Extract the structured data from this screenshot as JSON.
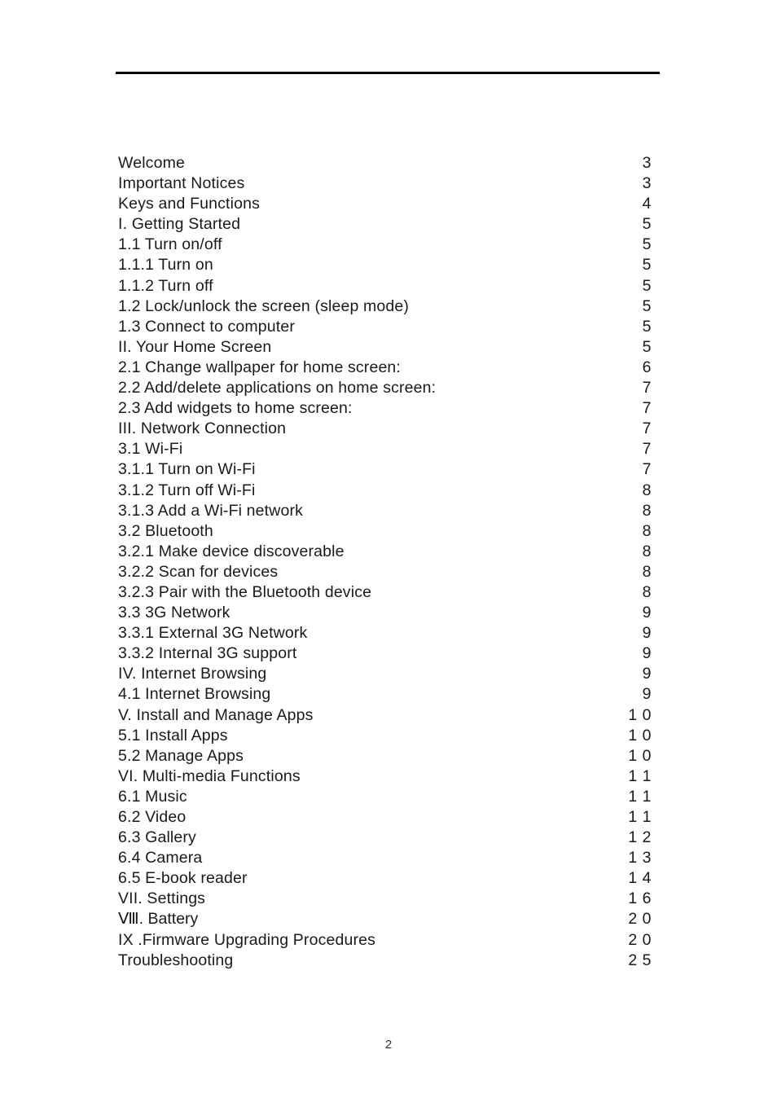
{
  "document": {
    "footer_page_number": "2",
    "header_rule_color": "#000000",
    "text_color": "#1a1a1a"
  },
  "toc": {
    "entries": [
      {
        "title": "Welcome",
        "page": "3"
      },
      {
        "title": "Important Notices",
        "page": "3"
      },
      {
        "title": "Keys and Functions",
        "page": "4"
      },
      {
        "title": "I. Getting Started",
        "page": "5"
      },
      {
        "title": "1.1 Turn on/off",
        "page": "5"
      },
      {
        "title": "1.1.1 Turn on",
        "page": "5"
      },
      {
        "title": "1.1.2 Turn off",
        "page": "5"
      },
      {
        "title": "1.2 Lock/unlock the screen (sleep mode)",
        "page": "5"
      },
      {
        "title": "1.3 Connect to computer",
        "page": "5"
      },
      {
        "title": "II. Your Home Screen",
        "page": "5"
      },
      {
        "title": "2.1 Change wallpaper for home screen:",
        "page": "6"
      },
      {
        "title": "2.2 Add/delete applications on home screen:",
        "page": "7"
      },
      {
        "title": "2.3 Add widgets to home screen:",
        "page": "7"
      },
      {
        "title": "III. Network Connection",
        "page": "7"
      },
      {
        "title": "3.1 Wi-Fi",
        "page": "7"
      },
      {
        "title": "3.1.1 Turn on Wi-Fi",
        "page": "7"
      },
      {
        "title": "3.1.2 Turn off Wi-Fi",
        "page": "8"
      },
      {
        "title": "3.1.3 Add a Wi-Fi network",
        "page": "8"
      },
      {
        "title": "3.2 Bluetooth",
        "page": "8"
      },
      {
        "title": "3.2.1 Make device discoverable",
        "page": "8"
      },
      {
        "title": "3.2.2 Scan for devices",
        "page": "8"
      },
      {
        "title": "3.2.3 Pair with the Bluetooth device",
        "page": "8"
      },
      {
        "title": "3.3 3G Network",
        "page": "9"
      },
      {
        "title": "3.3.1 External 3G Network",
        "page": "9"
      },
      {
        "title": "3.3.2 Internal 3G support",
        "page": "9"
      },
      {
        "title": "IV. Internet Browsing",
        "page": "9"
      },
      {
        "title": "4.1 Internet Browsing",
        "page": "9"
      },
      {
        "title": "V. Install and Manage Apps",
        "page": "1 0"
      },
      {
        "title": "5.1 Install Apps",
        "page": "1 0"
      },
      {
        "title": "5.2 Manage Apps",
        "page": "1 0"
      },
      {
        "title": "VI. Multi-media Functions",
        "page": "1 1"
      },
      {
        "title": "6.1 Music",
        "page": "1 1"
      },
      {
        "title": "6.2 Video",
        "page": "1 1"
      },
      {
        "title": "6.3 Gallery",
        "page": "1 2"
      },
      {
        "title": "6.4 Camera",
        "page": "1 3"
      },
      {
        "title": "6.5 E-book reader",
        "page": "1 4"
      },
      {
        "title": "VII. Settings",
        "page": "1 6"
      },
      {
        "title": "Ⅷ. Battery",
        "page": "2 0"
      },
      {
        "title": "IX .Firmware Upgrading Procedures",
        "page": "2 0"
      },
      {
        "title": "Troubleshooting",
        "page": "2 5"
      }
    ]
  }
}
